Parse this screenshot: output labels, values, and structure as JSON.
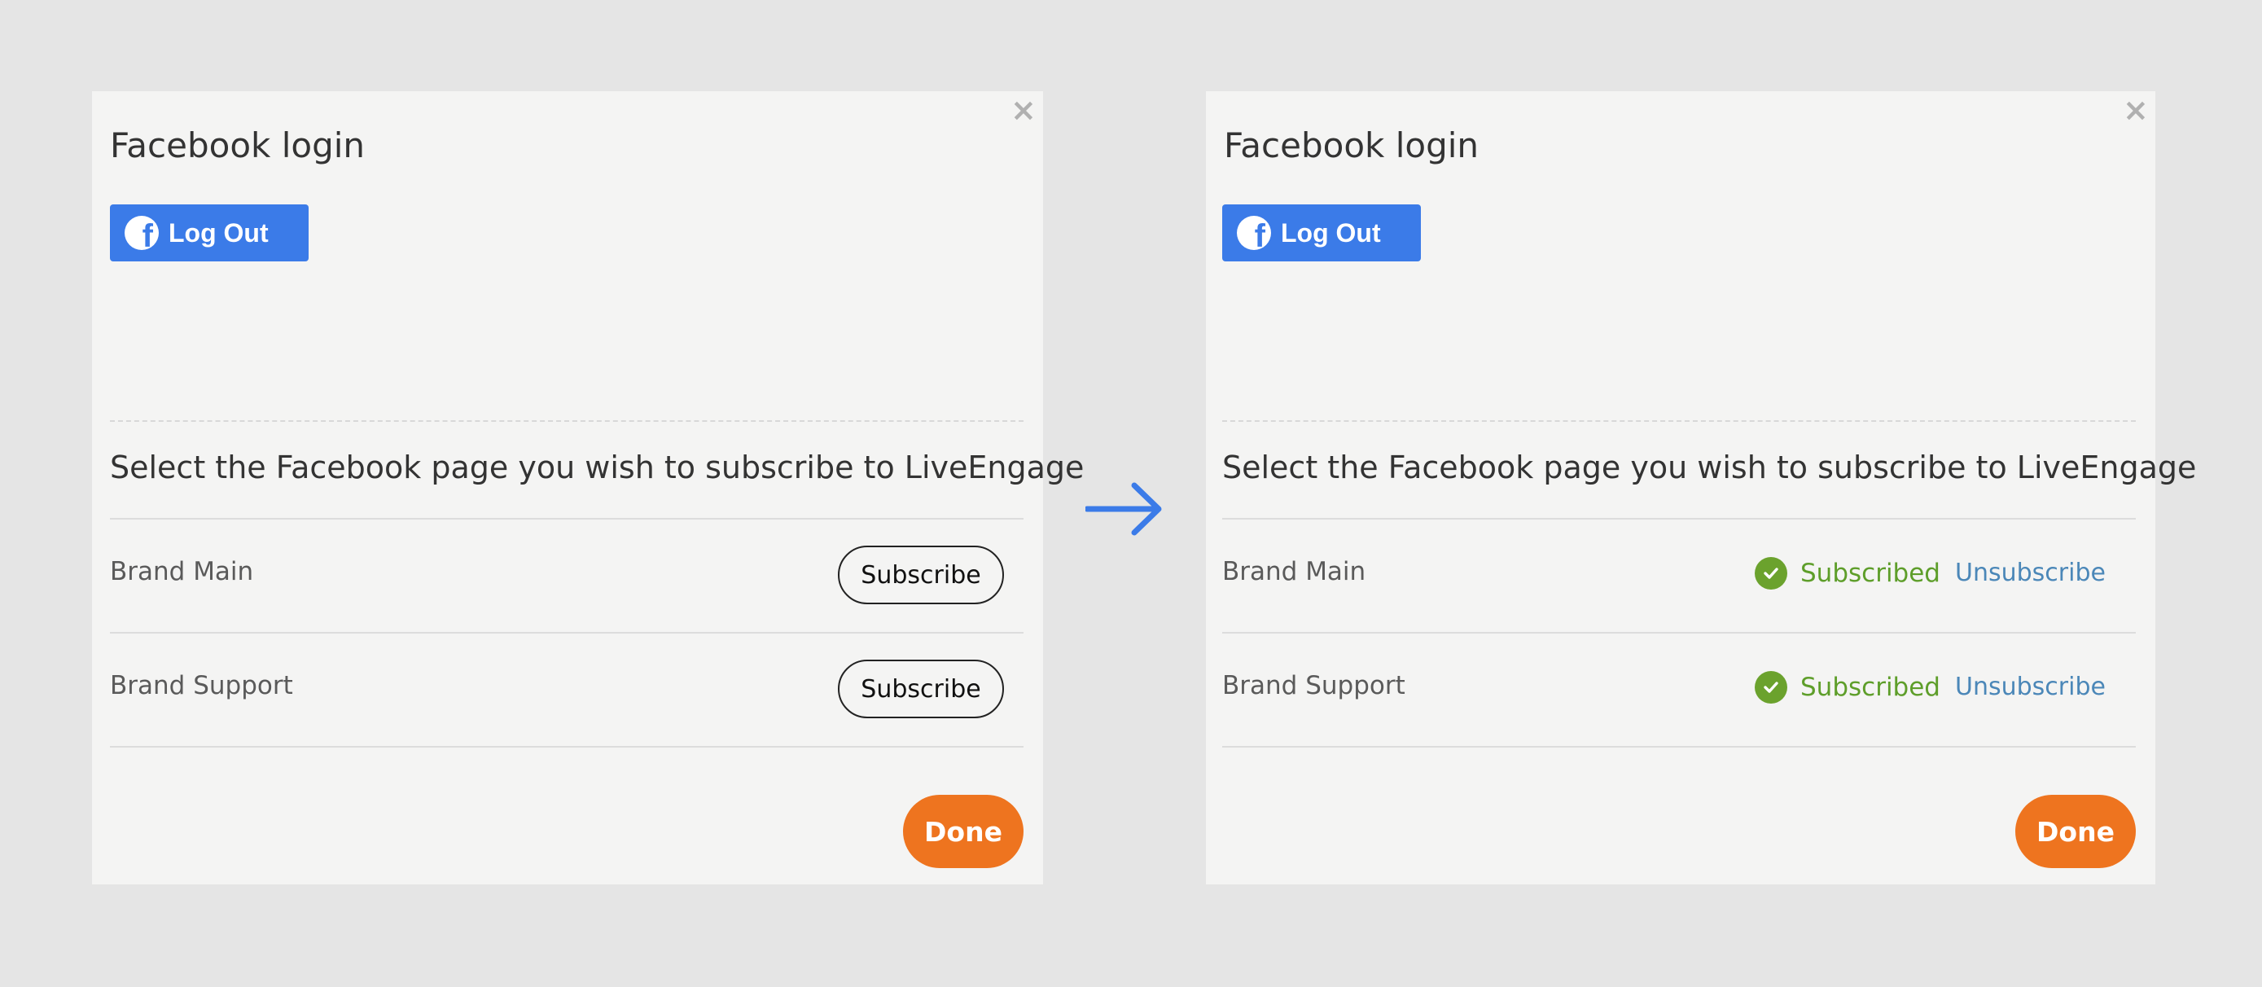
{
  "before": {
    "title": "Facebook login",
    "close_glyph": "×",
    "logout_label": "Log Out",
    "fb_glyph": "f",
    "subtitle": "Select the Facebook page you wish to subscribe to LiveEngage",
    "pages": [
      {
        "name": "Brand Main",
        "action": "Subscribe"
      },
      {
        "name": "Brand Support",
        "action": "Subscribe"
      }
    ],
    "done_label": "Done"
  },
  "after": {
    "title": "Facebook login",
    "close_glyph": "×",
    "logout_label": "Log Out",
    "fb_glyph": "f",
    "subtitle": "Select the Facebook page you wish to subscribe to LiveEngage",
    "pages": [
      {
        "name": "Brand Main",
        "status": "Subscribed",
        "action": "Unsubscribe"
      },
      {
        "name": "Brand Support",
        "status": "Subscribed",
        "action": "Unsubscribe"
      }
    ],
    "done_label": "Done"
  },
  "icons": {
    "close": "close-icon",
    "facebook": "facebook-icon",
    "check": "check-circle-icon",
    "arrow": "arrow-right-icon"
  },
  "colors": {
    "facebook_button": "#3b7be8",
    "done_button": "#ee741f",
    "subscribed": "#5e9e2a",
    "unsubscribe_link": "#4b87b8",
    "arrow": "#3b7be8"
  }
}
